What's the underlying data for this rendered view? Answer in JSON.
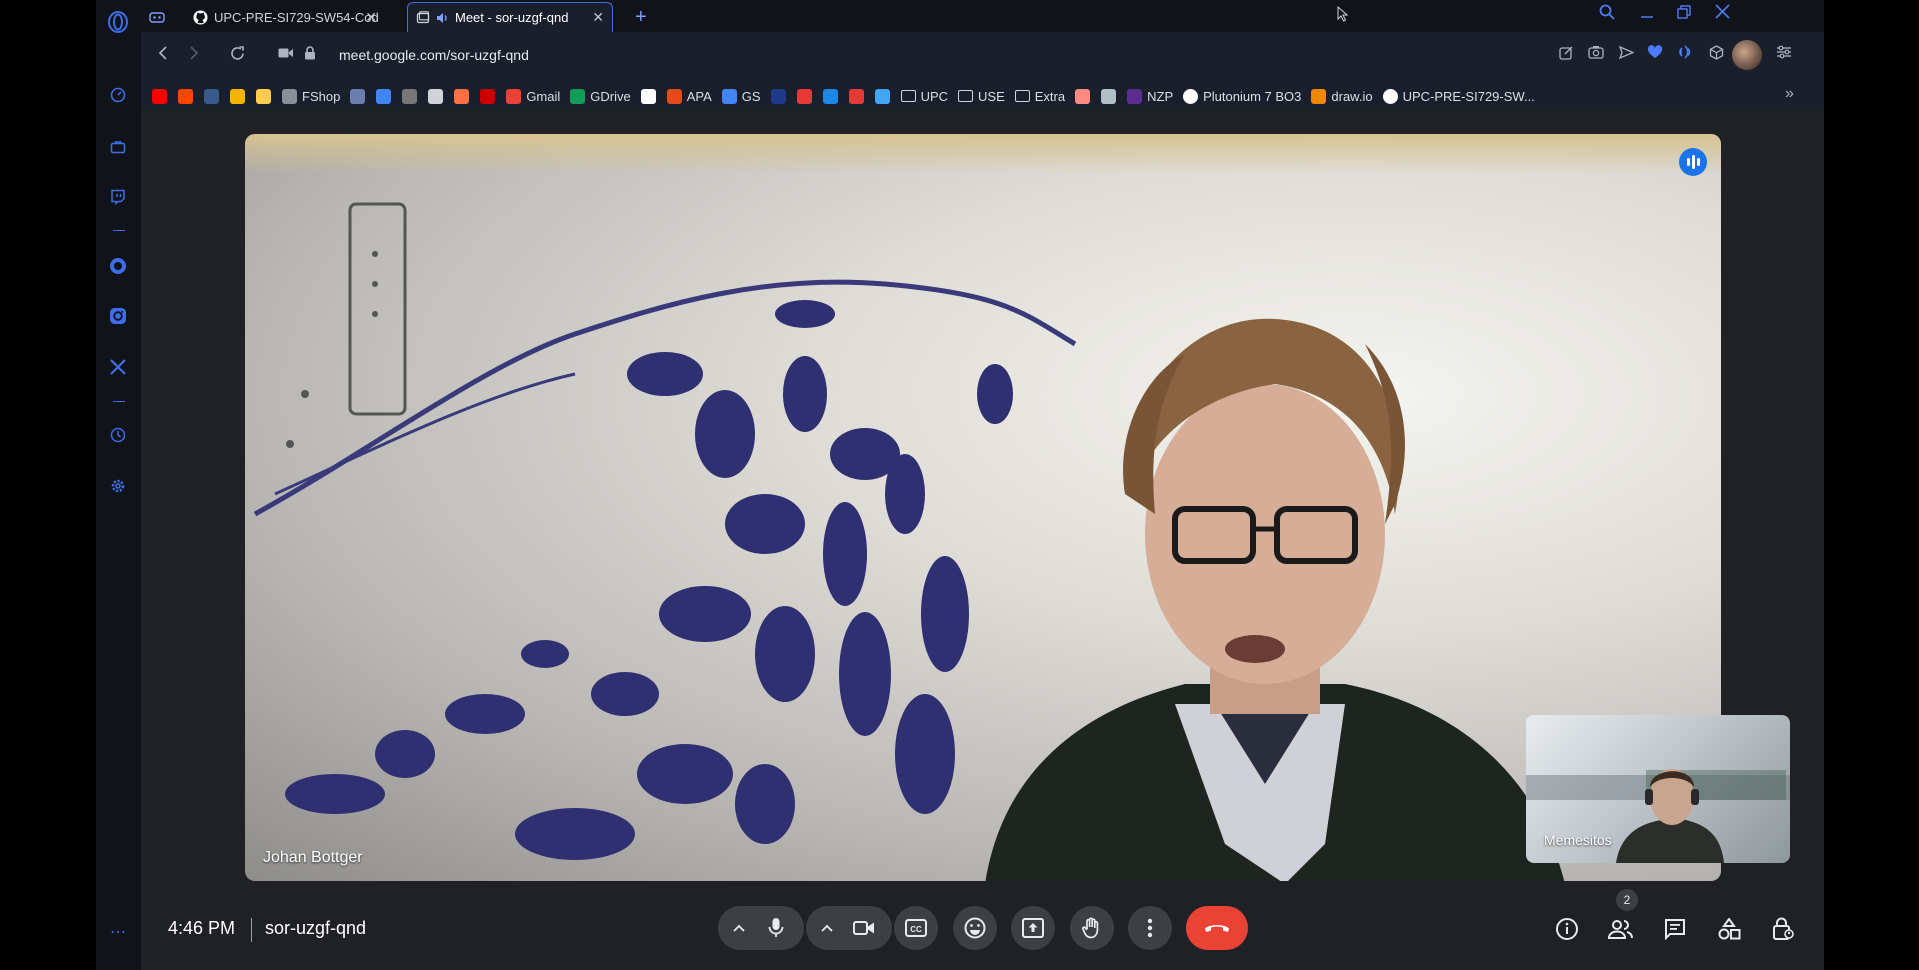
{
  "browser": {
    "tabs": [
      {
        "label": "UPC-PRE-SI729-SW54-Cod",
        "icon": "github-icon"
      },
      {
        "label": "Meet - sor-uzgf-qnd",
        "icon": "meet-icon",
        "active": true
      }
    ],
    "url": "meet.google.com/sor-uzgf-qnd",
    "bookmarks": [
      {
        "label": "",
        "color": "#ff0000"
      },
      {
        "label": "",
        "color": "#ff4500"
      },
      {
        "label": "",
        "color": "#3b5a8c"
      },
      {
        "label": "",
        "color": "#f4b400"
      },
      {
        "label": "",
        "color": "#ffcc4d"
      },
      {
        "label": "FShop",
        "color": "#8a8f98"
      },
      {
        "label": "",
        "color": "#6a7fb0"
      },
      {
        "label": "",
        "color": "#4285f4"
      },
      {
        "label": "",
        "color": "#777"
      },
      {
        "label": "",
        "color": "#d0d4da"
      },
      {
        "label": "",
        "color": "#ff7043"
      },
      {
        "label": "",
        "color": "#cc0000"
      },
      {
        "label": "Gmail",
        "color": "#ea4335"
      },
      {
        "label": "GDrive",
        "color": "#0f9d58"
      },
      {
        "label": "",
        "color": "#ffffff"
      },
      {
        "label": "APA",
        "color": "#e64a19"
      },
      {
        "label": "GS",
        "color": "#4285f4"
      },
      {
        "label": "",
        "color": "#1e3a8a"
      },
      {
        "label": "",
        "color": "#e53935"
      },
      {
        "label": "",
        "color": "#1e88e5"
      },
      {
        "label": "",
        "color": "#e53935"
      },
      {
        "label": "",
        "color": "#42a5f5"
      },
      {
        "label": "UPC",
        "color": "folder"
      },
      {
        "label": "USE",
        "color": "folder"
      },
      {
        "label": "Extra",
        "color": "folder"
      },
      {
        "label": "",
        "color": "#ff8a80"
      },
      {
        "label": "",
        "color": "#b0bec5"
      },
      {
        "label": "NZP",
        "color": "#5c2d91"
      },
      {
        "label": "Plutonium 7 BO3",
        "color": "github"
      },
      {
        "label": "draw.io",
        "color": "#f08705"
      },
      {
        "label": "UPC-PRE-SI729-SW...",
        "color": "github"
      }
    ],
    "overflow_label": "»"
  },
  "meet": {
    "speaker_name": "Johan Bottger",
    "self_name": "Memesitos",
    "time": "4:46 PM",
    "meeting_code": "sor-uzgf-qnd",
    "participants_count": "2",
    "colors": {
      "end_call": "#ea4335",
      "control_bg": "#3c4043",
      "accent": "#1a73e8",
      "browser_accent": "#3d6ee8"
    }
  }
}
